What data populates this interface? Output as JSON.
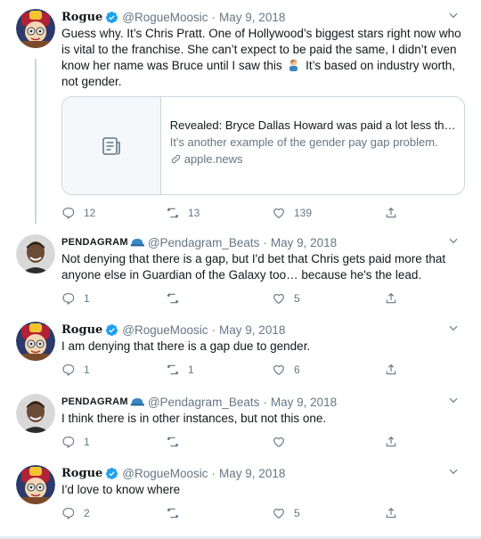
{
  "tweets": [
    {
      "name": "Rogue",
      "handle": "@RogueMoosic",
      "date": "May 9, 2018",
      "text_before_emoji": "Guess why. It’s Chris Pratt. One of Hollywood’s biggest stars right now who is vital to the franchise. She can’t expect to be paid the same, I didn’t even know her name was Bruce until I saw this",
      "text_after_emoji": " It’s based on industry worth, not gender.",
      "card": {
        "title": "Revealed: Bryce Dallas Howard was paid a lot less tha...",
        "description": "It's another example of the gender pay gap problem.",
        "link": "apple.news"
      },
      "replies": "12",
      "retweets": "13",
      "likes": "139"
    },
    {
      "name": "PENDAGRAM",
      "handle": "@Pendagram_Beats",
      "date": "May 9, 2018",
      "text": "Not denying that there is a gap, but I'd bet that Chris gets paid more that anyone else in Guardian of the Galaxy too… because he's the lead.",
      "replies": "1",
      "retweets": "",
      "likes": "5"
    },
    {
      "name": "Rogue",
      "handle": "@RogueMoosic",
      "date": "May 9, 2018",
      "text": "I am denying that there is a gap due to gender.",
      "replies": "1",
      "retweets": "1",
      "likes": "6"
    },
    {
      "name": "PENDAGRAM",
      "handle": "@Pendagram_Beats",
      "date": "May 9, 2018",
      "text": "I think there is in other instances, but not this one.",
      "replies": "1",
      "retweets": "",
      "likes": ""
    },
    {
      "name": "Rogue",
      "handle": "@RogueMoosic",
      "date": "May 9, 2018",
      "text": "I'd love to know where",
      "replies": "2",
      "retweets": "",
      "likes": "5"
    }
  ],
  "separator": "·",
  "icons": {
    "verified": "verified-badge-icon",
    "caret": "chevron-down-icon",
    "reply": "reply-icon",
    "retweet": "retweet-icon",
    "like": "heart-icon",
    "share": "share-icon",
    "article": "article-icon",
    "link": "link-icon",
    "emoji": "man-facepalming-emoji",
    "helmet": "blue-helmet-icon"
  },
  "colors": {
    "text": "#14171a",
    "secondary": "#657786",
    "verified": "#1da1f2",
    "border": "#ccd6dd"
  }
}
